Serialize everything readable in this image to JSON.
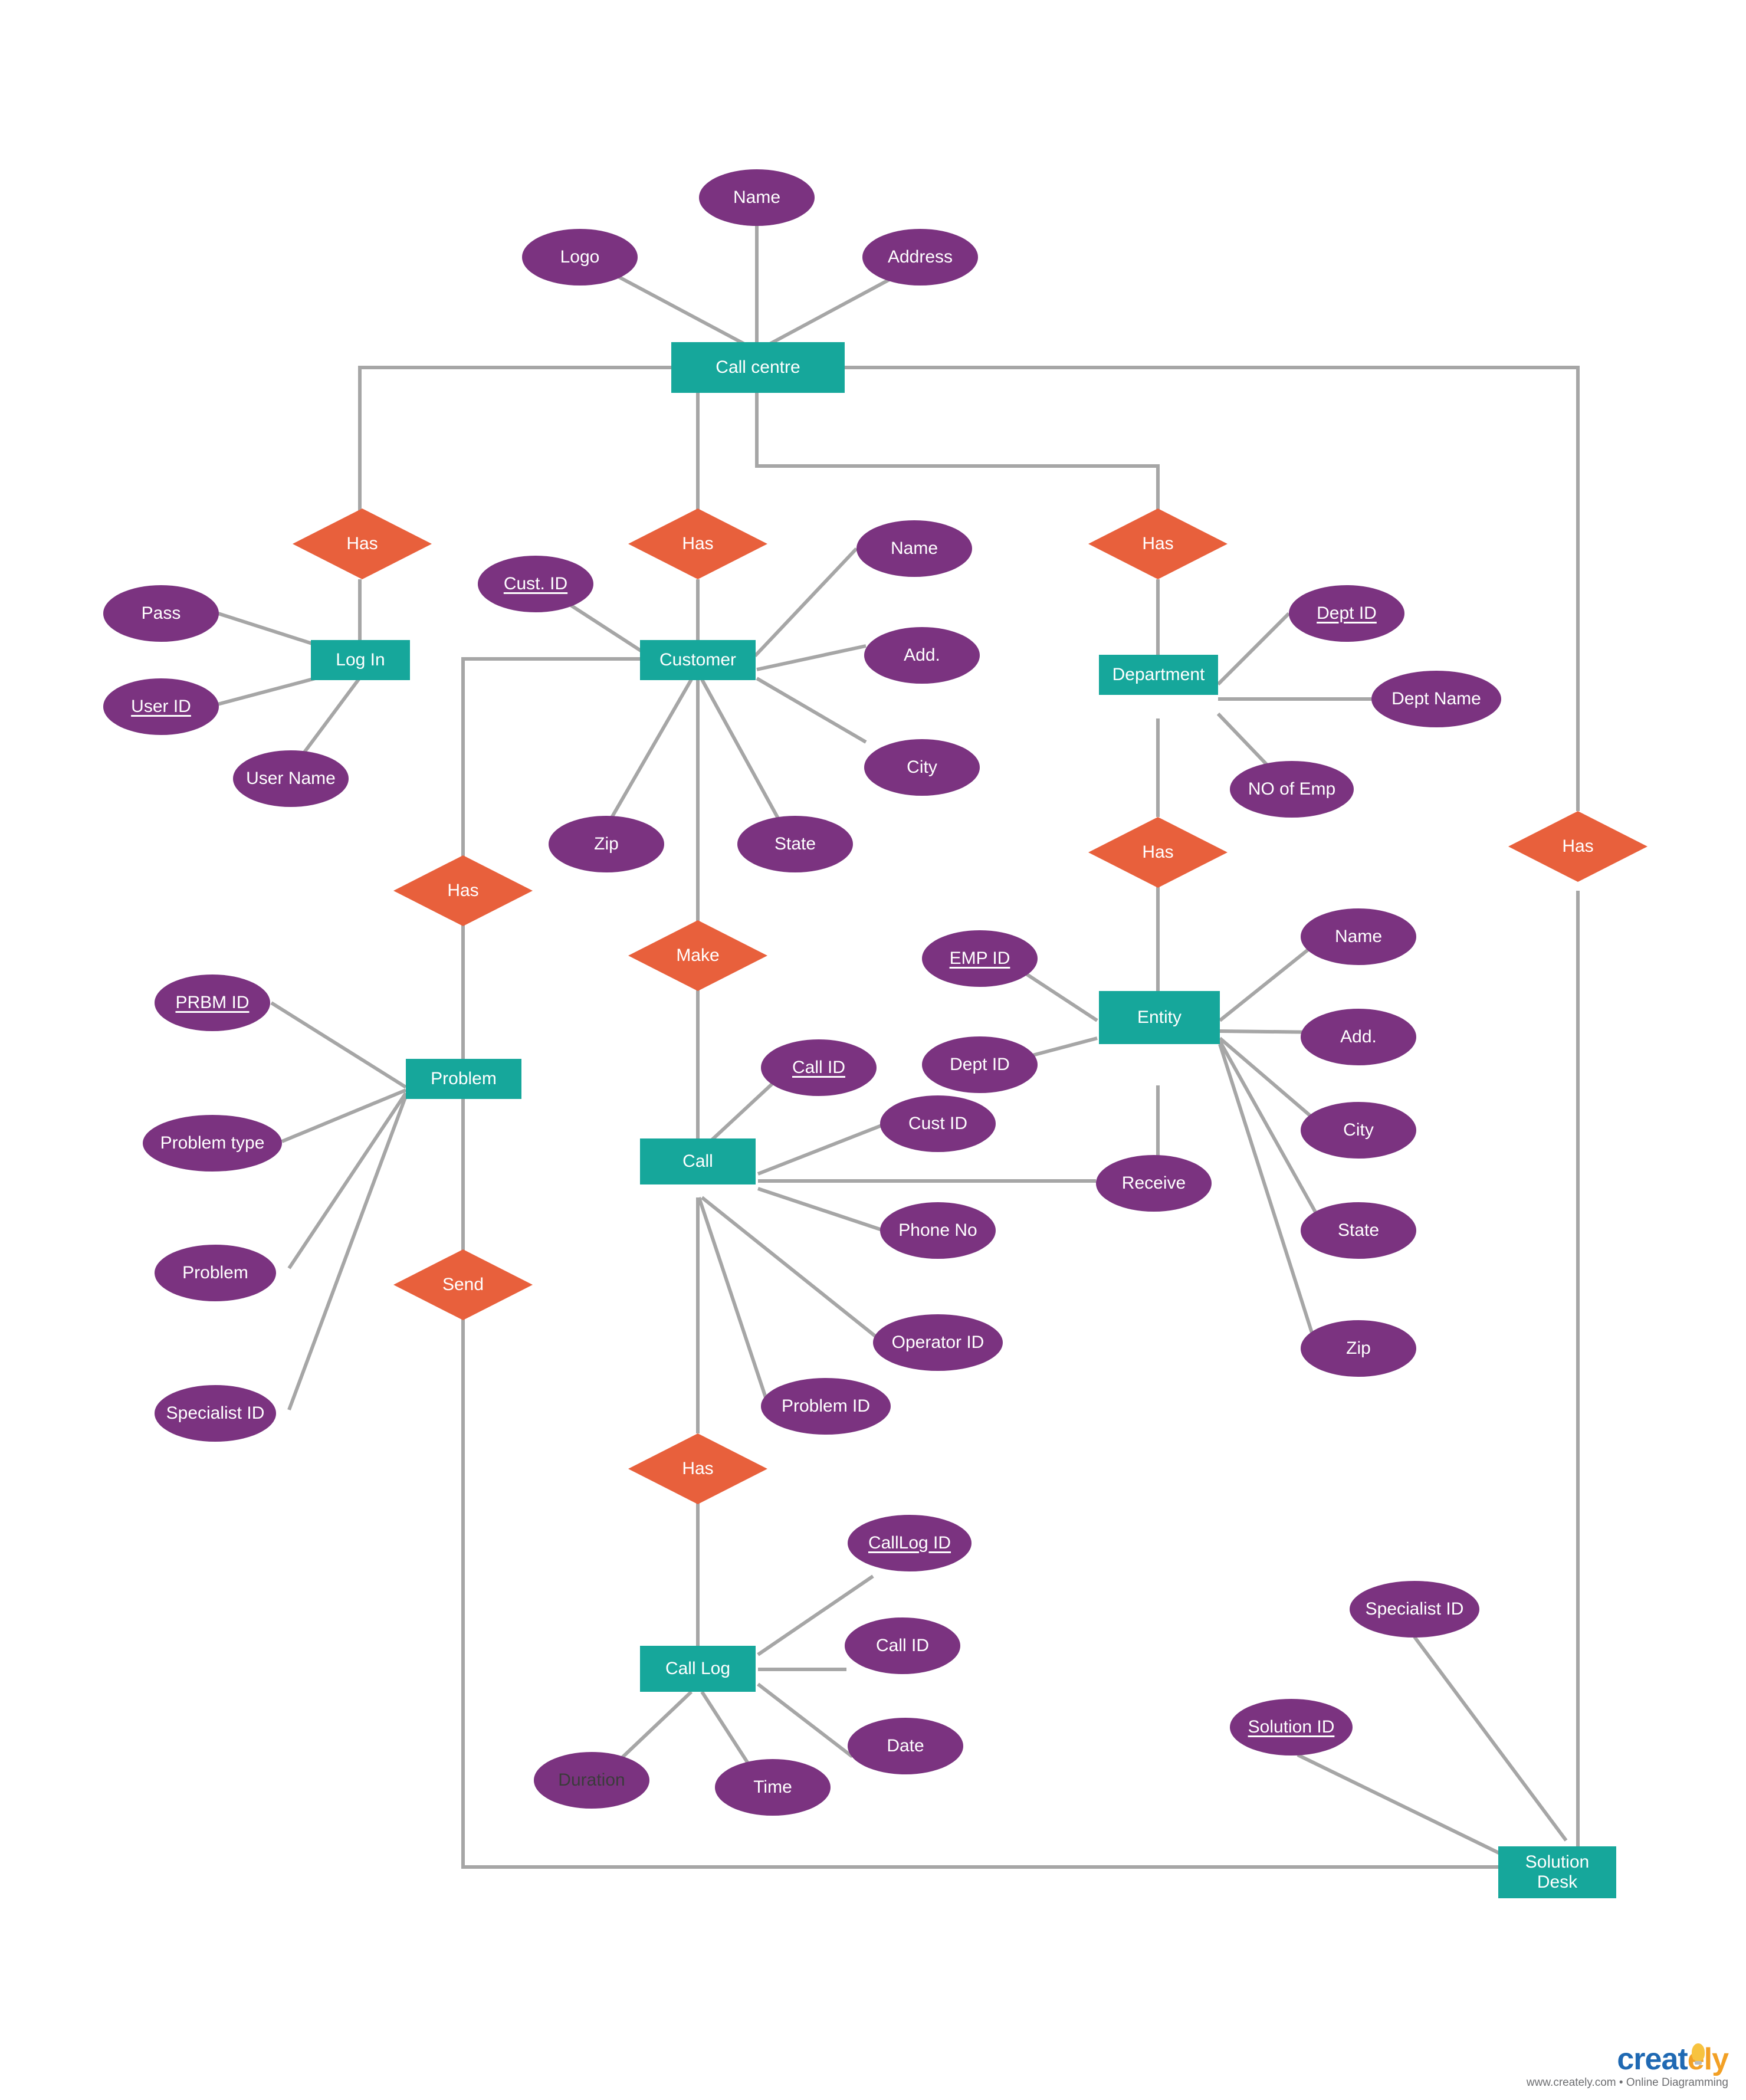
{
  "diagram": {
    "title": "Call centre ER Diagram",
    "colors": {
      "entity": "#16a79b",
      "attribute": "#7b3380",
      "relationship": "#e8603c",
      "edge": "#a6a6a6",
      "text_light": "#ffffff",
      "text_dark": "#3b3b3b",
      "background": "#ffffff"
    }
  },
  "nodes": {
    "entities": [
      {
        "id": "call_centre",
        "label": "Call centre"
      },
      {
        "id": "log_in",
        "label": "Log In"
      },
      {
        "id": "customer",
        "label": "Customer"
      },
      {
        "id": "department",
        "label": "Department"
      },
      {
        "id": "problem",
        "label": "Problem"
      },
      {
        "id": "call",
        "label": "Call"
      },
      {
        "id": "entity",
        "label": "Entity"
      },
      {
        "id": "call_log",
        "label": "Call Log"
      },
      {
        "id": "solution_desk",
        "label": "Solution\nDesk"
      }
    ],
    "relationships": [
      {
        "id": "has_login",
        "label": "Has"
      },
      {
        "id": "has_customer",
        "label": "Has"
      },
      {
        "id": "has_dept",
        "label": "Has"
      },
      {
        "id": "has_right",
        "label": "Has"
      },
      {
        "id": "has_entity",
        "label": "Has"
      },
      {
        "id": "has_problem",
        "label": "Has"
      },
      {
        "id": "make_call",
        "label": "Make"
      },
      {
        "id": "send",
        "label": "Send"
      },
      {
        "id": "has_calllog",
        "label": "Has"
      }
    ],
    "attributes": [
      {
        "id": "cc_name",
        "label": "Name",
        "key": false,
        "owner": "call_centre"
      },
      {
        "id": "cc_logo",
        "label": "Logo",
        "key": false,
        "owner": "call_centre"
      },
      {
        "id": "cc_address",
        "label": "Address",
        "key": false,
        "owner": "call_centre"
      },
      {
        "id": "li_pass",
        "label": "Pass",
        "key": false,
        "owner": "log_in"
      },
      {
        "id": "li_userid",
        "label": "User ID",
        "key": true,
        "owner": "log_in"
      },
      {
        "id": "li_username",
        "label": "User Name",
        "key": false,
        "owner": "log_in"
      },
      {
        "id": "cu_custid",
        "label": "Cust. ID",
        "key": true,
        "owner": "customer"
      },
      {
        "id": "cu_name",
        "label": "Name",
        "key": false,
        "owner": "customer"
      },
      {
        "id": "cu_add",
        "label": "Add.",
        "key": false,
        "owner": "customer"
      },
      {
        "id": "cu_city",
        "label": "City",
        "key": false,
        "owner": "customer"
      },
      {
        "id": "cu_zip",
        "label": "Zip",
        "key": false,
        "owner": "customer"
      },
      {
        "id": "cu_state",
        "label": "State",
        "key": false,
        "owner": "customer"
      },
      {
        "id": "dp_deptid",
        "label": "Dept ID",
        "key": true,
        "owner": "department"
      },
      {
        "id": "dp_deptname",
        "label": "Dept Name",
        "key": false,
        "owner": "department"
      },
      {
        "id": "dp_noofemp",
        "label": "NO of Emp",
        "key": false,
        "owner": "department"
      },
      {
        "id": "pr_prbmid",
        "label": "PRBM ID",
        "key": true,
        "owner": "problem"
      },
      {
        "id": "pr_problemtype",
        "label": "Problem type",
        "key": false,
        "owner": "problem"
      },
      {
        "id": "pr_problem",
        "label": "Problem",
        "key": false,
        "owner": "problem"
      },
      {
        "id": "pr_specialistid",
        "label": "Specialist ID",
        "key": false,
        "owner": "problem"
      },
      {
        "id": "ca_callid",
        "label": "Call ID",
        "key": true,
        "owner": "call"
      },
      {
        "id": "ca_custid",
        "label": "Cust ID",
        "key": false,
        "owner": "call"
      },
      {
        "id": "ca_phoneno",
        "label": "Phone No",
        "key": false,
        "owner": "call"
      },
      {
        "id": "ca_operatorid",
        "label": "Operator ID",
        "key": false,
        "owner": "call"
      },
      {
        "id": "ca_problemid",
        "label": "Problem ID",
        "key": false,
        "owner": "call"
      },
      {
        "id": "ca_receive",
        "label": "Receive",
        "key": false,
        "owner": "call"
      },
      {
        "id": "en_empid",
        "label": "EMP ID",
        "key": true,
        "owner": "entity"
      },
      {
        "id": "en_deptid",
        "label": "Dept ID",
        "key": false,
        "owner": "entity"
      },
      {
        "id": "en_name",
        "label": "Name",
        "key": false,
        "owner": "entity"
      },
      {
        "id": "en_add",
        "label": "Add.",
        "key": false,
        "owner": "entity"
      },
      {
        "id": "en_city",
        "label": "City",
        "key": false,
        "owner": "entity"
      },
      {
        "id": "en_state",
        "label": "State",
        "key": false,
        "owner": "entity"
      },
      {
        "id": "en_zip",
        "label": "Zip",
        "key": false,
        "owner": "entity"
      },
      {
        "id": "cl_calllogid",
        "label": "CallLog ID",
        "key": true,
        "owner": "call_log"
      },
      {
        "id": "cl_callid",
        "label": "Call ID",
        "key": false,
        "owner": "call_log"
      },
      {
        "id": "cl_date",
        "label": "Date",
        "key": false,
        "owner": "call_log"
      },
      {
        "id": "cl_time",
        "label": "Time",
        "key": false,
        "owner": "call_log"
      },
      {
        "id": "cl_duration",
        "label": "Duration",
        "key": false,
        "owner": "call_log",
        "dark": true
      },
      {
        "id": "sd_solutionid",
        "label": "Solution ID",
        "key": true,
        "owner": "solution_desk"
      },
      {
        "id": "sd_specialistid",
        "label": "Specialist ID",
        "key": false,
        "owner": "solution_desk"
      }
    ]
  },
  "brand": {
    "name_left": "creat",
    "name_e": "e",
    "name_ly": "ly",
    "tagline": "www.creately.com • Online Diagramming"
  }
}
